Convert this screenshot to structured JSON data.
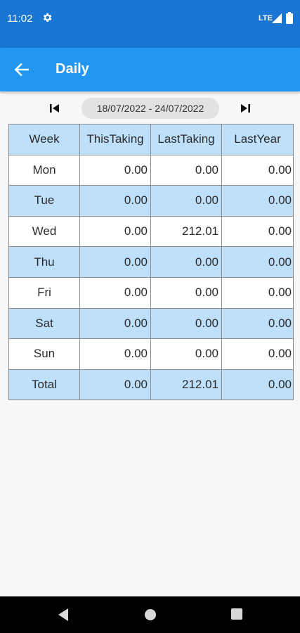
{
  "status_bar": {
    "time": "11:02",
    "network": "LTE",
    "icons": [
      "gear-icon",
      "signal-icon",
      "battery-icon"
    ]
  },
  "app_bar": {
    "title": "Daily",
    "back_icon": "arrow-left-icon",
    "color": "#2196f3"
  },
  "date_nav": {
    "range": "18/07/2022 - 24/07/2022",
    "first_icon": "skip-previous-icon",
    "last_icon": "skip-next-icon"
  },
  "table": {
    "headers": [
      "Week",
      "ThisTaking",
      "LastTaking",
      "LastYear"
    ],
    "rows": [
      {
        "day": "Mon",
        "this": "0.00",
        "last": "0.00",
        "year": "0.00"
      },
      {
        "day": "Tue",
        "this": "0.00",
        "last": "0.00",
        "year": "0.00"
      },
      {
        "day": "Wed",
        "this": "0.00",
        "last": "212.01",
        "year": "0.00"
      },
      {
        "day": "Thu",
        "this": "0.00",
        "last": "0.00",
        "year": "0.00"
      },
      {
        "day": "Fri",
        "this": "0.00",
        "last": "0.00",
        "year": "0.00"
      },
      {
        "day": "Sat",
        "this": "0.00",
        "last": "0.00",
        "year": "0.00"
      },
      {
        "day": "Sun",
        "this": "0.00",
        "last": "0.00",
        "year": "0.00"
      },
      {
        "day": "Total",
        "this": "0.00",
        "last": "212.01",
        "year": "0.00"
      }
    ],
    "header_color": "#bfe0fb"
  },
  "nav_bar": {
    "icons": [
      "nav-back-icon",
      "nav-home-icon",
      "nav-recents-icon"
    ]
  }
}
